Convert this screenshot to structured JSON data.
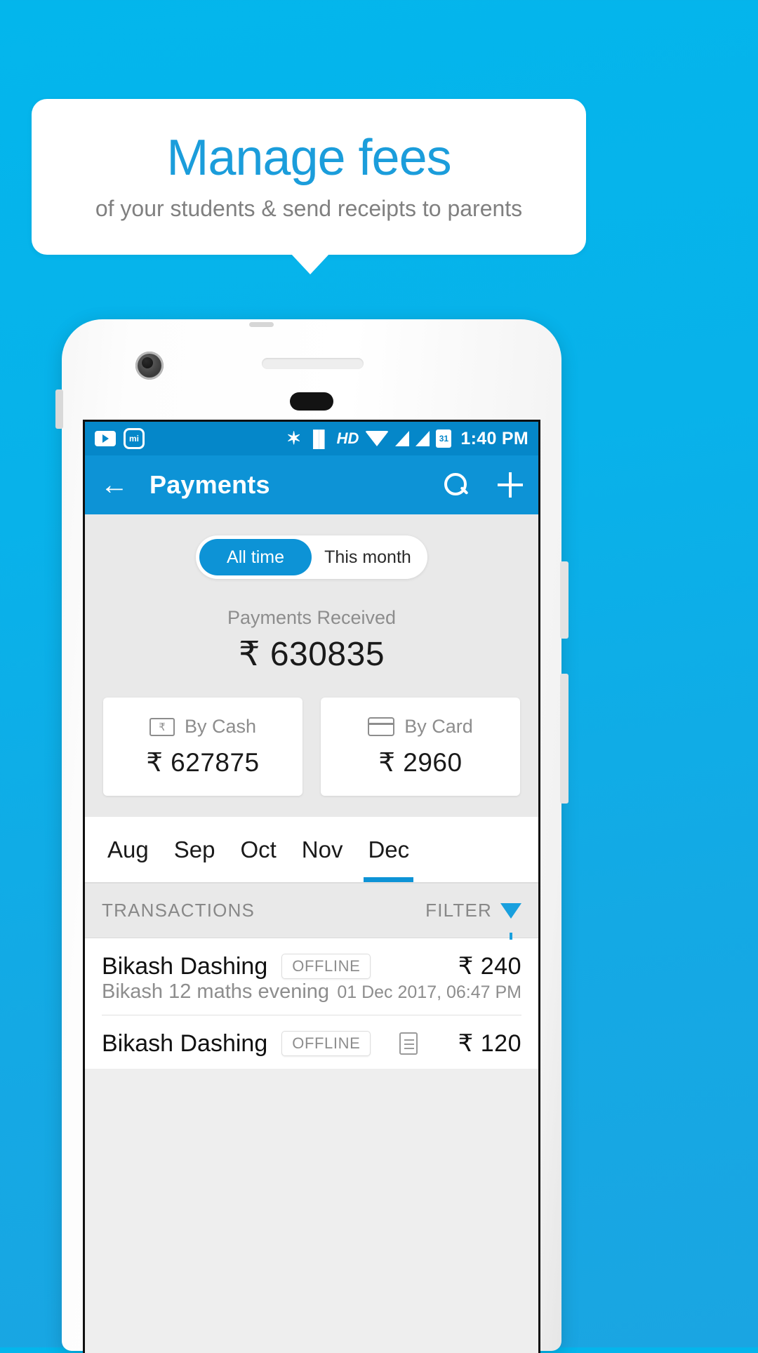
{
  "promo": {
    "title": "Manage fees",
    "subtitle": "of your students & send receipts to parents"
  },
  "colors": {
    "background_blue": "#0bb3ea",
    "brand_blue": "#0d93d6",
    "statusbar_blue": "#0587c9",
    "title_blue": "#1b9ddb",
    "muted_gray": "#8d8d8d"
  },
  "statusbar": {
    "icons_left": [
      "youtube-icon",
      "mi-cloud-icon"
    ],
    "icons_right": [
      "bluetooth-icon",
      "vibrate-icon",
      "hd-icon",
      "wifi-icon",
      "signal-icon",
      "signal-icon",
      "calendar-icon"
    ],
    "bluetooth_glyph": "✶",
    "vibrate_glyph": "▐▌",
    "hd_label": "HD",
    "battery_label": "31",
    "time": "1:40 PM"
  },
  "toolbar": {
    "back_glyph": "←",
    "title": "Payments",
    "search_label": "search-icon",
    "add_label": "plus-icon"
  },
  "summary": {
    "segments": [
      {
        "label": "All time",
        "active": true
      },
      {
        "label": "This month",
        "active": false
      }
    ],
    "received_label": "Payments Received",
    "received_amount": "₹ 630835",
    "cards": [
      {
        "icon": "cash-note-icon",
        "icon_glyph": "₹",
        "label": "By Cash",
        "amount": "₹ 627875"
      },
      {
        "icon": "credit-card-icon",
        "label": "By Card",
        "amount": "₹ 2960"
      }
    ]
  },
  "month_tabs": [
    {
      "label": "Aug",
      "active": false
    },
    {
      "label": "Sep",
      "active": false
    },
    {
      "label": "Oct",
      "active": false
    },
    {
      "label": "Nov",
      "active": false
    },
    {
      "label": "Dec",
      "active": true
    }
  ],
  "transactions_header": {
    "title": "TRANSACTIONS",
    "filter_label": "FILTER",
    "filter_icon": "filter-funnel-icon"
  },
  "transactions": [
    {
      "name": "Bikash Dashing",
      "badge": "OFFLINE",
      "amount": "₹ 240",
      "description": "Bikash 12 maths evening",
      "date": "01 Dec 2017, 06:47 PM",
      "has_receipt": false
    },
    {
      "name": "Bikash Dashing",
      "badge": "OFFLINE",
      "amount": "₹ 120",
      "description": "",
      "date": "",
      "has_receipt": true
    }
  ]
}
